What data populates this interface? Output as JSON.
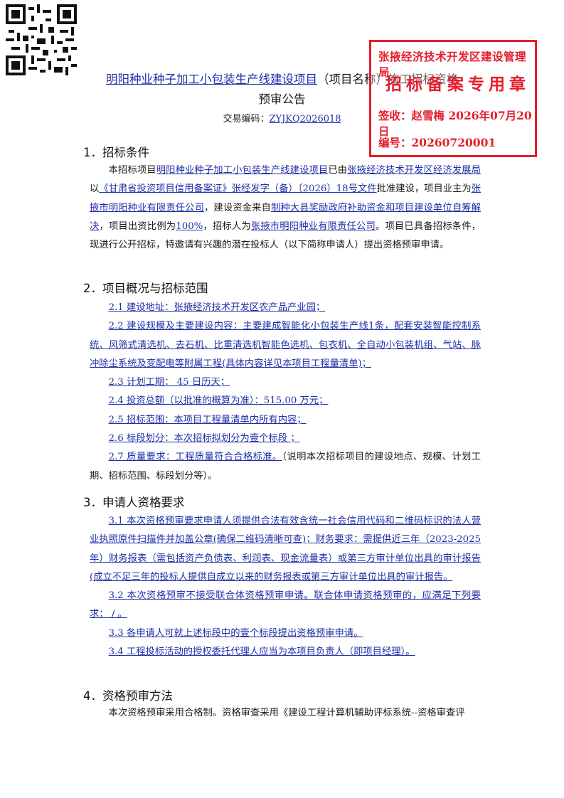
{
  "title": {
    "project_name": "明阳种业种子加工小包装生产线建设项目",
    "rest_line1": "（项目名称）施工招标资格",
    "line2": "预审公告"
  },
  "transaction": {
    "label": "交易编码：",
    "code": "ZYJKQ2026018"
  },
  "stamp": {
    "org": "张掖经济技术开发区建设管理局",
    "purpose": "招标备案专用章",
    "signer": "签收：赵雪梅 2026年07月20日",
    "number": "编号：20260720001"
  },
  "section1": {
    "heading": "1．招标条件",
    "t1": "本招标项目",
    "project": "明阳种业种子加工小包装生产线建设项目",
    "t2": "已由",
    "approver": "张掖经济技术开发区经济发展局",
    "t3": "以",
    "doc": "《甘肃省投资项目信用备案证》张经发字（备）〔2026〕18号文件",
    "t4": "批准建设，项目业主为",
    "owner": "张掖市明阳种业有限责任公司",
    "t5": "，建设资金来自",
    "funds": "制种大县奖励政府补助资金和项目建设单位自筹解决",
    "t6": "，项目出资比例为",
    "ratio": "100%",
    "t7": "，招标人为",
    "tenderer": "张掖市明阳种业有限责任公司",
    "t8": "。项目已具备招标条件，现进行公开招标，特邀请有兴趣的潜在投标人（以下简称申请人）提出资格预审申请。"
  },
  "section2": {
    "heading": "2．项目概况与招标范围",
    "items": [
      "2.1  建设地址：张掖经济技术开发区农产品产业园；",
      "2.2  建设规模及主要建设内容：主要建成智能化小包装生产线1条，配套安装智能控制系统、风筛式清选机、去石机、比重清选机智能色选机、包衣机、全自动小包装机组、气站、脉冲除尘系统及变配电等附属工程(具体内容详见本项目工程量清单)；",
      "2.3  计划工期：  45 日历天；",
      "2.4 投资总额（以批准的概算为准）：515.00 万元；",
      "2.5  招标范围：本项目工程量清单内所有内容；",
      "2.6  标段划分：本次招标拟划分为壹个标段 ；"
    ],
    "item7": "2.7  质量要求：工程质量符合合格标准。",
    "item7_note": "（说明本次招标项目的建设地点、规模、计划工期、招标范围、标段划分等）。"
  },
  "section3": {
    "heading": "3．申请人资格要求",
    "items": [
      "3.1 本次资格预审要求申请人须提供合法有效含统一社会信用代码和二维码标识的法人营业执照原件扫描件并加盖公章(确保二维码清晰可查)；财务要求：需提供近三年（2023-2025年）财务报表（需包括资产负债表、利润表、现金流量表）或第三方审计单位出具的审计报告(成立不足三年的投标人提供自成立以来的财务报表或第三方审计单位出具的审计报告。",
      "3.2  本次资格预审不接受联合体资格预审申请。联合体申请资格预审的，应满足下列要求：  /    。",
      "3.3  各申请人可就上述标段中的壹个标段提出资格预审申请。",
      "3.4 工程投标活动的授权委托代理人应当为本项目负责人（即项目经理）。"
    ]
  },
  "section4": {
    "heading": "4．资格预审方法",
    "text": "本次资格预审采用合格制。资格审查采用《建设工程计算机辅助评标系统--资格审查评"
  }
}
